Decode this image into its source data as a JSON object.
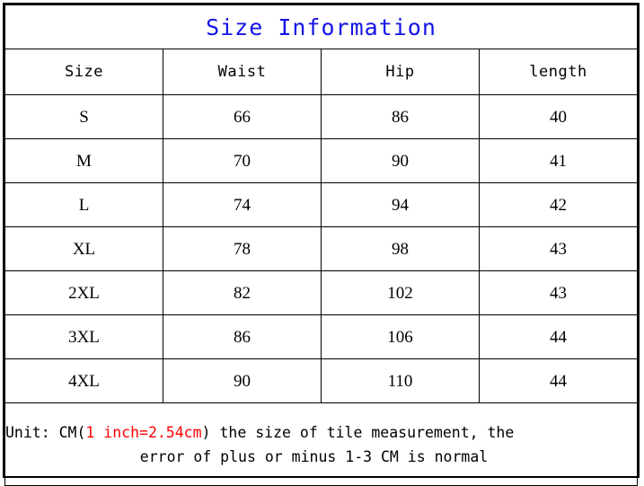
{
  "title": {
    "text": "Size Information",
    "color": "#1414e6"
  },
  "table": {
    "columns": [
      "Size",
      "Waist",
      "Hip",
      "length"
    ],
    "rows": [
      {
        "size": "S",
        "waist": "66",
        "hip": "86",
        "length": "40"
      },
      {
        "size": "M",
        "waist": "70",
        "hip": "90",
        "length": "41"
      },
      {
        "size": "L",
        "waist": "74",
        "hip": "94",
        "length": "42"
      },
      {
        "size": "XL",
        "waist": "78",
        "hip": "98",
        "length": "43"
      },
      {
        "size": "2XL",
        "waist": "82",
        "hip": "102",
        "length": "43"
      },
      {
        "size": "3XL",
        "waist": "86",
        "hip": "106",
        "length": "44"
      },
      {
        "size": "4XL",
        "waist": "90",
        "hip": "110",
        "length": "44"
      }
    ]
  },
  "note": {
    "prefix": "Unit: CM(",
    "conversion": "1 inch=2.54cm",
    "suffix": ")",
    "line1_rest": "the size of tile measurement, the",
    "line2": "error of plus or minus 1-3 CM is normal",
    "conversion_color": "#ff0000"
  },
  "chart_data": {
    "type": "table",
    "title": "Size Information",
    "columns": [
      "Size",
      "Waist",
      "Hip",
      "length"
    ],
    "units": "CM",
    "categories": [
      "S",
      "M",
      "L",
      "XL",
      "2XL",
      "3XL",
      "4XL"
    ],
    "series": [
      {
        "name": "Waist",
        "values": [
          66,
          70,
          74,
          78,
          82,
          86,
          90
        ]
      },
      {
        "name": "Hip",
        "values": [
          86,
          90,
          94,
          98,
          102,
          106,
          110
        ]
      },
      {
        "name": "length",
        "values": [
          40,
          41,
          42,
          43,
          43,
          44,
          44
        ]
      }
    ],
    "annotations": [
      "Unit: CM(1 inch=2.54cm)",
      "the size of tile measurement, the error of plus or minus 1-3 CM is normal"
    ]
  }
}
